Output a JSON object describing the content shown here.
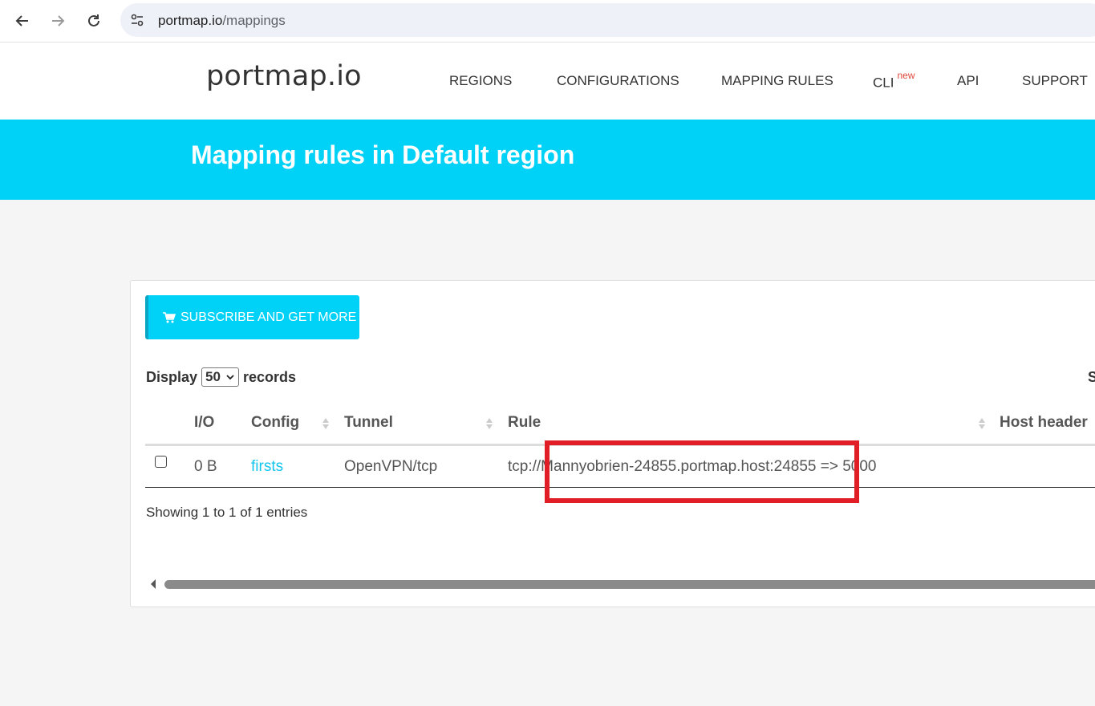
{
  "browser": {
    "url_host": "portmap.io",
    "url_path": "/mappings"
  },
  "header": {
    "logo": "portmap.io",
    "nav": {
      "regions": "REGIONS",
      "configurations": "CONFIGURATIONS",
      "mapping_rules": "MAPPING RULES",
      "cli": "CLI",
      "cli_badge": "new",
      "api": "API",
      "support": "SUPPORT"
    }
  },
  "banner": {
    "title": "Mapping rules in Default region"
  },
  "panel": {
    "subscribe_label": "SUBSCRIBE AND GET MORE",
    "display_label": "Display",
    "display_value": "50",
    "records_label": "records",
    "search_partial": "S",
    "columns": {
      "io": "I/O",
      "config": "Config",
      "tunnel": "Tunnel",
      "rule": "Rule",
      "host_header": "Host header"
    },
    "rows": [
      {
        "io": "0 B",
        "config": "firsts",
        "tunnel": "OpenVPN/tcp",
        "rule": "tcp://Mannyobrien-24855.portmap.host:24855 => 5000"
      }
    ],
    "showing": "Showing 1 to 1 of 1 entries"
  },
  "colors": {
    "accent": "#00d1f7",
    "link": "#14c6ee",
    "highlight": "#e11d26"
  }
}
